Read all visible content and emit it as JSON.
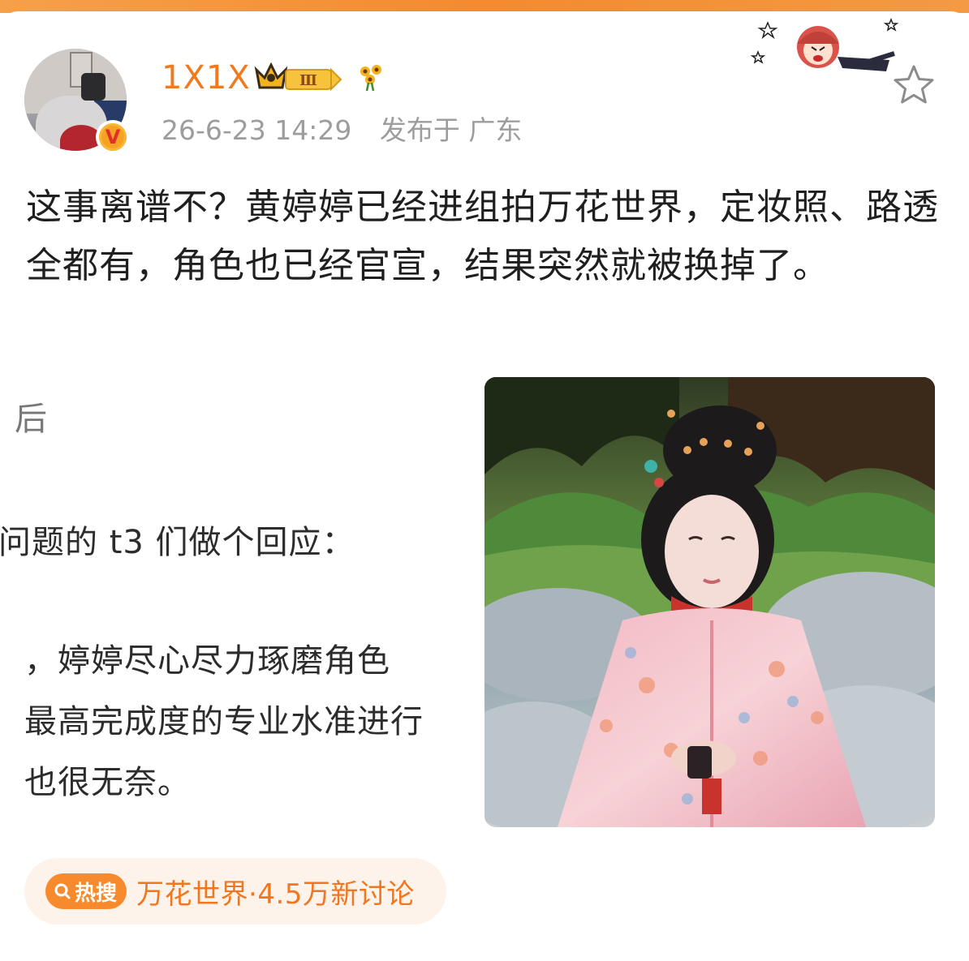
{
  "post": {
    "username": "1X1X",
    "level": "Ⅲ",
    "timestamp": "26-6-23 14:29",
    "location": "发布于 广东",
    "text": "这事离谱不？黄婷婷已经进组拍万花世界，定妆照、路透全都有，角色也已经官宣，结果突然就被换掉了。",
    "verified_badge": "V",
    "favorite_icon": "star-outline-icon"
  },
  "screenshot": {
    "line1": "后",
    "line2": "问题的 t3 们做个回应：",
    "line3": "，婷婷尽心尽力琢磨角色",
    "line4": "最高完成度的专业水准进行",
    "line5": "也很无奈。"
  },
  "hot_search": {
    "tag": "热搜",
    "text": "万花世界·4.5万新讨论"
  },
  "colors": {
    "accent": "#f27a1e",
    "meta_gray": "#9d9d9d",
    "hot_bg": "#fdf3ea",
    "top_bar": "#f58a2e"
  }
}
